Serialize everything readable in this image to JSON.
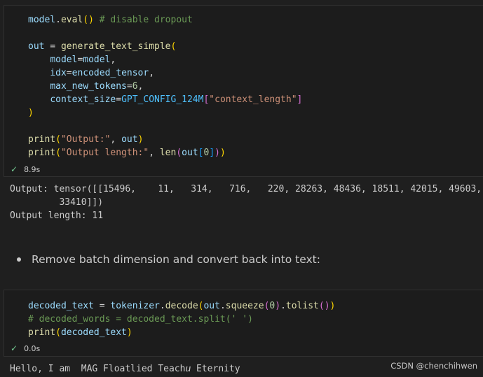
{
  "cells": [
    {
      "code_lines": [
        "model.eval() # disable dropout",
        "",
        "out = generate_text_simple(",
        "    model=model,",
        "    idx=encoded_tensor,",
        "    max_new_tokens=6,",
        "    context_size=GPT_CONFIG_124M[\"context_length\"]",
        ")",
        "",
        "print(\"Output:\", out)",
        "print(\"Output length:\", len(out[0]))"
      ],
      "exec_time": "8.9s",
      "output_lines": [
        "Output: tensor([[15496,    11,   314,   716,   220, 28263, 48436, 18511, 42015, 49603,",
        "         33410]])",
        "Output length: 11"
      ]
    },
    {
      "code_lines": [
        "decoded_text = tokenizer.decode(out.squeeze(0).tolist())",
        "# decoded_words = decoded_text.split(' ')",
        "print(decoded_text)"
      ],
      "exec_time": "0.0s",
      "output_lines": [
        "Hello, I am  MAG Floatlied Teachⴎ Eternity"
      ]
    }
  ],
  "markdown": {
    "bullet_text": "Remove batch dimension and convert back into text:"
  },
  "watermark": "CSDN @chenchihwen",
  "icons": {
    "success": "checkmark-icon"
  },
  "colors": {
    "background": "#1f1f1f",
    "cell_background": "#1c1c1c",
    "function": "#dcdcaa",
    "variable": "#9cdcfe",
    "comment": "#6a9955",
    "string": "#ce9178",
    "number": "#b5cea8",
    "constant": "#4fc1ff",
    "success": "#73c991"
  }
}
